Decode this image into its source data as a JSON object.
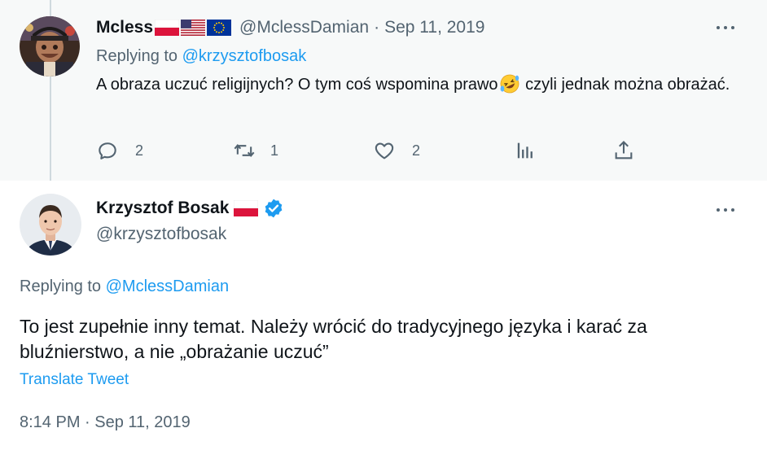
{
  "reply_tweet": {
    "display_name": "Mcless",
    "flags": [
      "poland-flag",
      "usa-flag",
      "eu-flag"
    ],
    "handle": "@MclessDamian",
    "separator": "·",
    "date": "Sep 11, 2019",
    "replying_prefix": "Replying to ",
    "replying_to": "@krzysztofbosak",
    "text_before_emoji": "A obraza uczuć religijnych? O tym coś wspomina prawo",
    "emoji": "rolling-on-floor-laughing-emoji",
    "text_after_emoji": " czyli jednak można obrażać.",
    "actions": {
      "reply_count": "2",
      "retweet_count": "1",
      "like_count": "2"
    }
  },
  "main_tweet": {
    "display_name": "Krzysztof Bosak",
    "flag": "poland-flag",
    "verified": true,
    "handle": "@krzysztofbosak",
    "replying_prefix": "Replying to ",
    "replying_to": "@MclessDamian",
    "text": "To jest zupełnie inny temat. Należy wrócić do tradycyjnego języka i karać za bluźnierstwo, a nie „obrażanie uczuć”",
    "translate_label": "Translate Tweet",
    "timestamp": "8:14 PM · Sep 11, 2019"
  },
  "colors": {
    "accent": "#1d9bf0",
    "secondary_text": "#536471",
    "primary_text": "#0f1419",
    "reply_background": "#f7f9f9"
  }
}
